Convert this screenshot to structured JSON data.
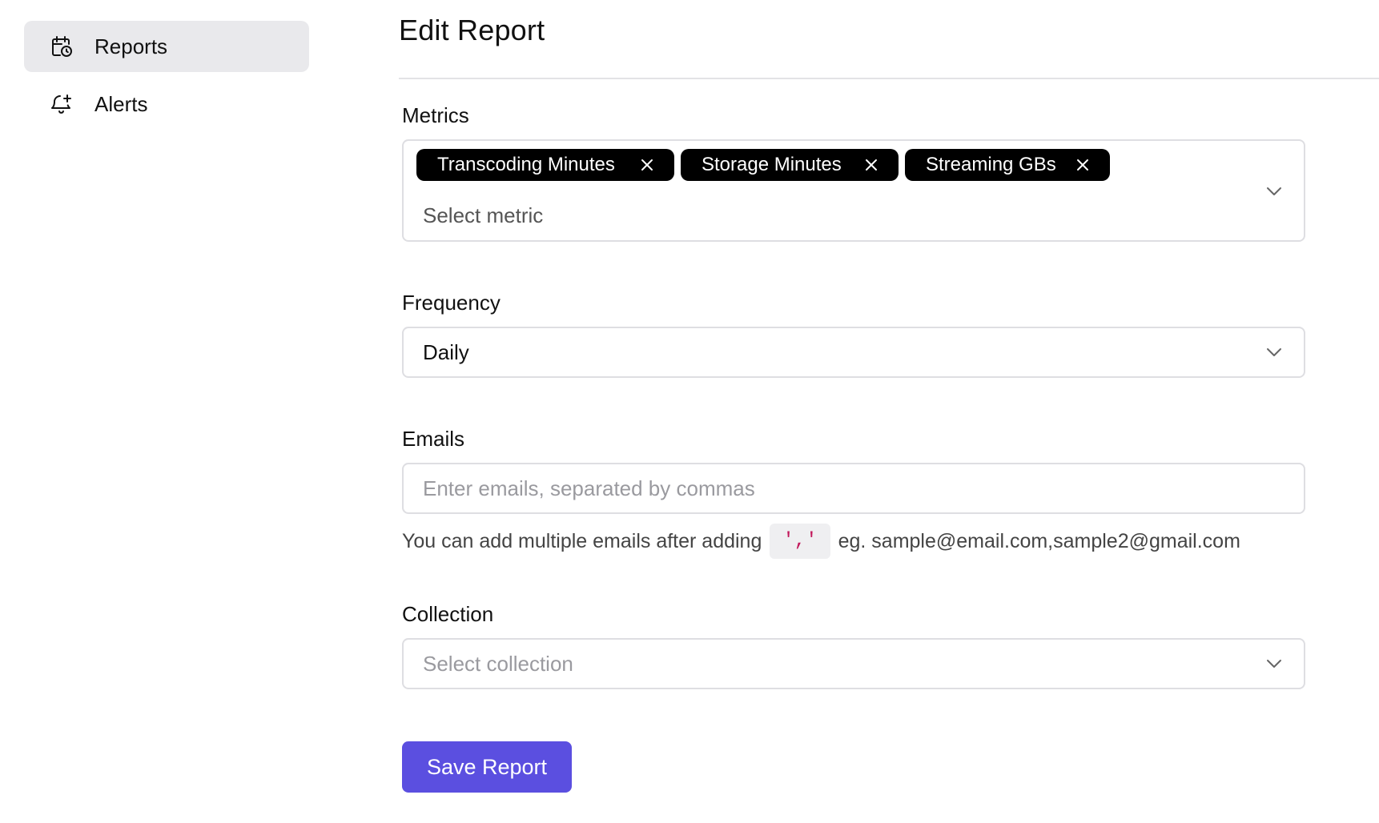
{
  "sidebar": {
    "items": [
      {
        "label": "Reports",
        "icon": "calendar-clock-icon",
        "active": true
      },
      {
        "label": "Alerts",
        "icon": "bell-plus-icon",
        "active": false
      }
    ]
  },
  "page": {
    "title": "Edit Report"
  },
  "metrics": {
    "label": "Metrics",
    "tags": [
      "Transcoding Minutes",
      "Storage Minutes",
      "Streaming GBs"
    ],
    "placeholder": "Select metric"
  },
  "frequency": {
    "label": "Frequency",
    "value": "Daily"
  },
  "emails": {
    "label": "Emails",
    "placeholder": "Enter emails, separated by commas",
    "help_prefix": "You can add multiple emails after adding",
    "help_code": "','",
    "help_suffix": "eg. sample@email.com,sample2@gmail.com"
  },
  "collection": {
    "label": "Collection",
    "placeholder": "Select collection"
  },
  "actions": {
    "save_label": "Save Report"
  },
  "colors": {
    "accent": "#5b4fe0",
    "tag_bg": "#000000",
    "active_nav_bg": "#e9e9ec"
  }
}
